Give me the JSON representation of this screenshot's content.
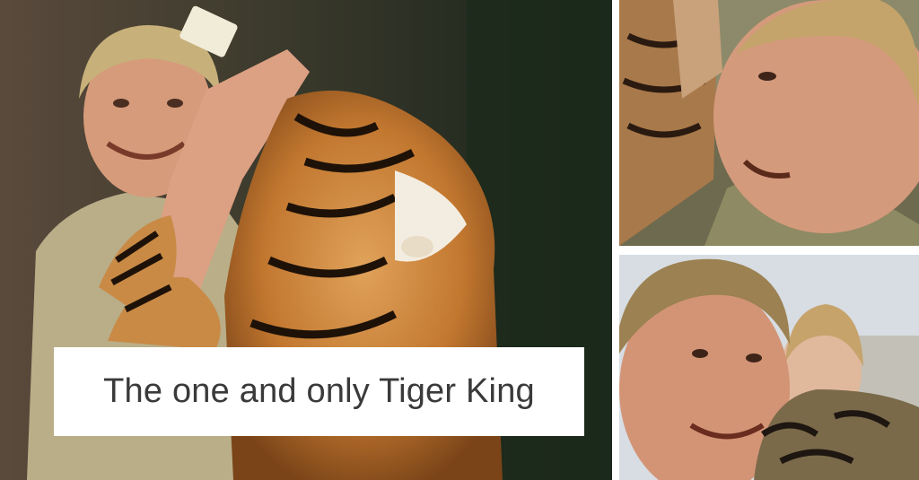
{
  "caption": {
    "text": "The one and only Tiger King"
  },
  "photos": {
    "main": {
      "subject": "man-feeding-tiger-with-bottle"
    },
    "top_right": {
      "subject": "smiling-man-with-tiger-cub"
    },
    "bottom_right": {
      "subject": "man-and-woman-with-tiger-cubs"
    }
  },
  "colors": {
    "background": "#ffffff",
    "caption_text": "#3a3a3a",
    "tiger_orange": "#c8792c",
    "foliage": "#1f2a1a"
  }
}
